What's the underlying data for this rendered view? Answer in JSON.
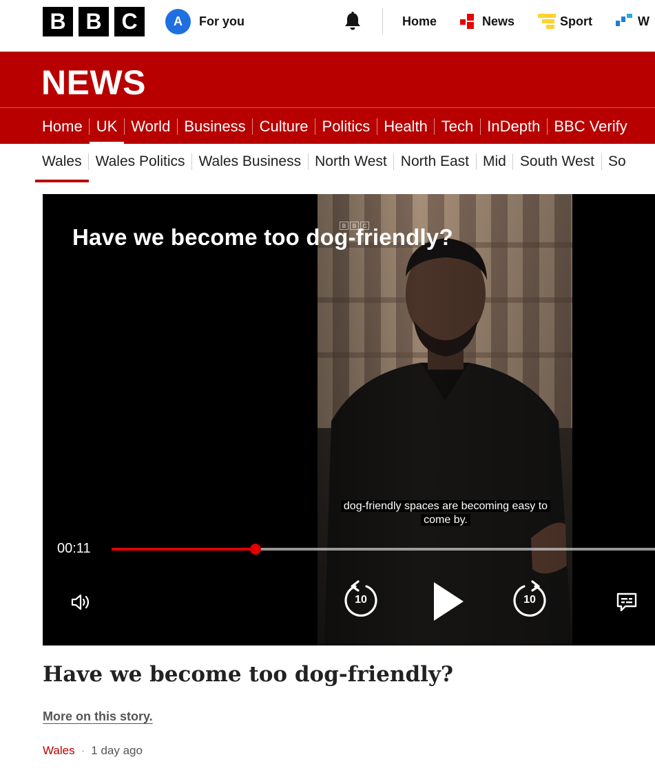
{
  "masthead": {
    "logo_letters": [
      "B",
      "B",
      "C"
    ],
    "account": {
      "initial": "A",
      "label": "For you"
    },
    "global_nav": [
      {
        "label": "Home",
        "icon": "none"
      },
      {
        "label": "News",
        "icon": "news-icon",
        "color": "#e60000"
      },
      {
        "label": "Sport",
        "icon": "sport-icon",
        "color": "#ffd230"
      },
      {
        "label": "W",
        "icon": "weather-icon",
        "color": "#1a7fd6"
      }
    ]
  },
  "news_banner": {
    "wordmark": "NEWS",
    "color": "#b80000",
    "sections": [
      "Home",
      "UK",
      "World",
      "Business",
      "Culture",
      "Politics",
      "Health",
      "Tech",
      "InDepth",
      "BBC Verify"
    ],
    "active_section": "UK"
  },
  "sub_nav": {
    "items": [
      "Wales",
      "Wales Politics",
      "Wales Business",
      "North West",
      "North East",
      "Mid",
      "South West",
      "So"
    ],
    "active_item": "Wales"
  },
  "video": {
    "title": "Have we become too dog-friendly?",
    "watermark": [
      "B",
      "B",
      "C"
    ],
    "caption": "dog-friendly spaces are becoming easy to come by.",
    "current_time": "00:11",
    "progress_fraction": 0.265,
    "progress_color": "#e10000",
    "skip_back": "10",
    "skip_forward": "10"
  },
  "article": {
    "title": "Have we become too dog-friendly?",
    "more_link": "More on this story.",
    "topic": "Wales",
    "separator": "·",
    "time_ago": "1 day ago"
  }
}
